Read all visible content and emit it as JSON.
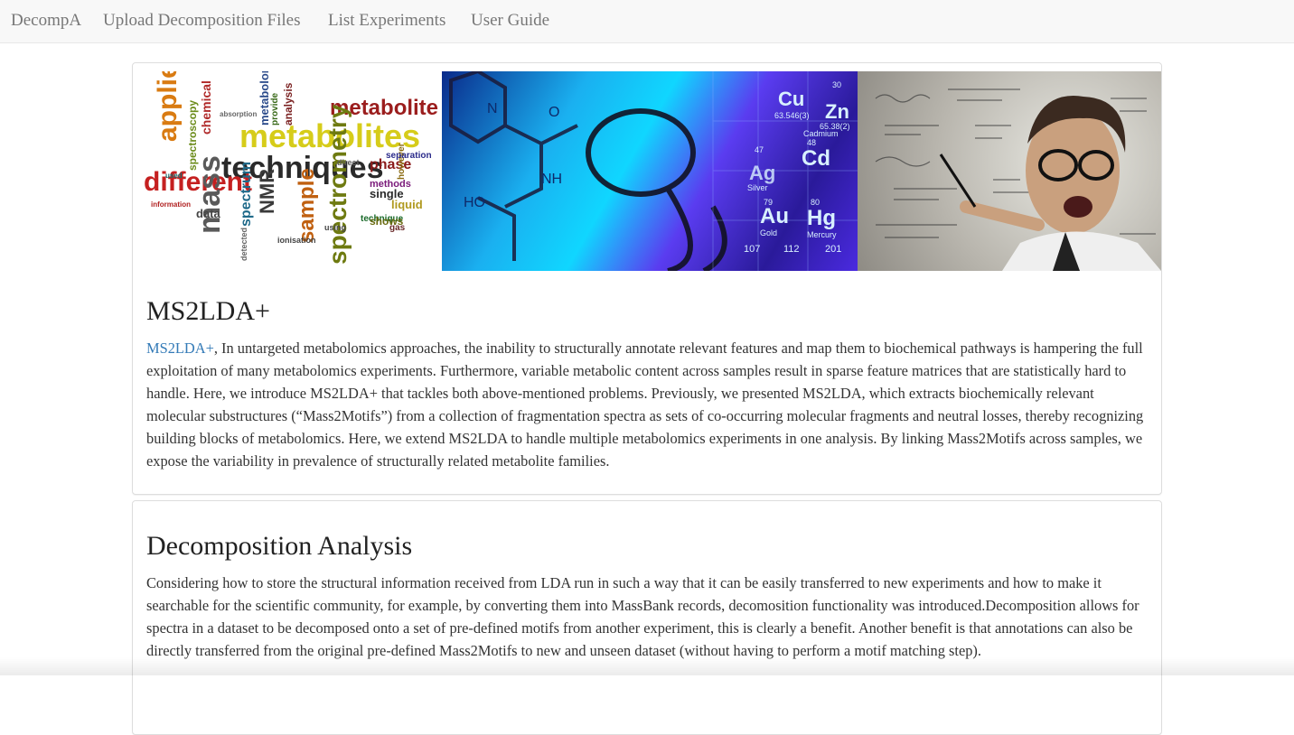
{
  "navbar": {
    "brand": "DecompA",
    "items": [
      {
        "label": "Upload Decomposition Files"
      },
      {
        "label": "List Experiments"
      },
      {
        "label": "User Guide"
      }
    ]
  },
  "banner": {
    "wordcloud_words": [
      "applied",
      "metabolite",
      "metabolites",
      "techniques",
      "different",
      "mass",
      "spectrometry",
      "sample",
      "NMR",
      "spectrum",
      "analysis",
      "chemical",
      "spectroscopy",
      "phase",
      "data",
      "single",
      "liquid",
      "methods",
      "technique",
      "ionisation",
      "detected",
      "information",
      "provide",
      "however",
      "direct",
      "separation",
      "absorption",
      "shows",
      "metabolomics",
      "using",
      "gas",
      "used"
    ],
    "chem_labels": [
      "Cu",
      "Zn",
      "Cd",
      "Ag",
      "Au",
      "Hg",
      "NH",
      "HO",
      "O",
      "N",
      "Cadmium",
      "Silver",
      "Gold",
      "Mercury",
      "30",
      "48",
      "47",
      "79",
      "80",
      "65.38(2)",
      "63.546(3)",
      "112",
      "201",
      "107"
    ]
  },
  "colors": {
    "link": "#337ab7",
    "nav_bg": "#f8f8f8",
    "nav_text": "#777777"
  },
  "section1": {
    "title": "MS2LDA+",
    "link_text": "MS2LDA+",
    "text": ", In untargeted metabolomics approaches, the inability to structurally annotate relevant features and map them to biochemical pathways is hampering the full exploitation of many metabolomics experiments. Furthermore, variable metabolic content across samples result in sparse feature matrices that are statistically hard to handle. Here, we introduce MS2LDA+ that tackles both above-mentioned problems. Previously, we presented MS2LDA, which extracts biochemically relevant molecular substructures (“Mass2Motifs”) from a collection of fragmentation spectra as sets of co-occurring molecular fragments and neutral losses, thereby recognizing building blocks of metabolomics. Here, we extend MS2LDA to handle multiple metabolomics experiments in one analysis. By linking Mass2Motifs across samples, we expose the variability in prevalence of structurally related metabolite families."
  },
  "section2": {
    "title": "Decomposition Analysis",
    "text": "Considering how to store the structural information received from LDA run in such a way that it can be easily transferred to new experiments and how to make it searchable for the scientific community, for example, by converting them into MassBank records, decomosition functionality was introduced.Decomposition allows for spectra in a dataset to be decomposed onto a set of pre-defined motifs from another experiment, this is clearly a benefit. Another benefit is that annotations can also be directly transferred from the original pre-defined Mass2Motifs to new and unseen dataset (without having to perform a motif matching step)."
  }
}
